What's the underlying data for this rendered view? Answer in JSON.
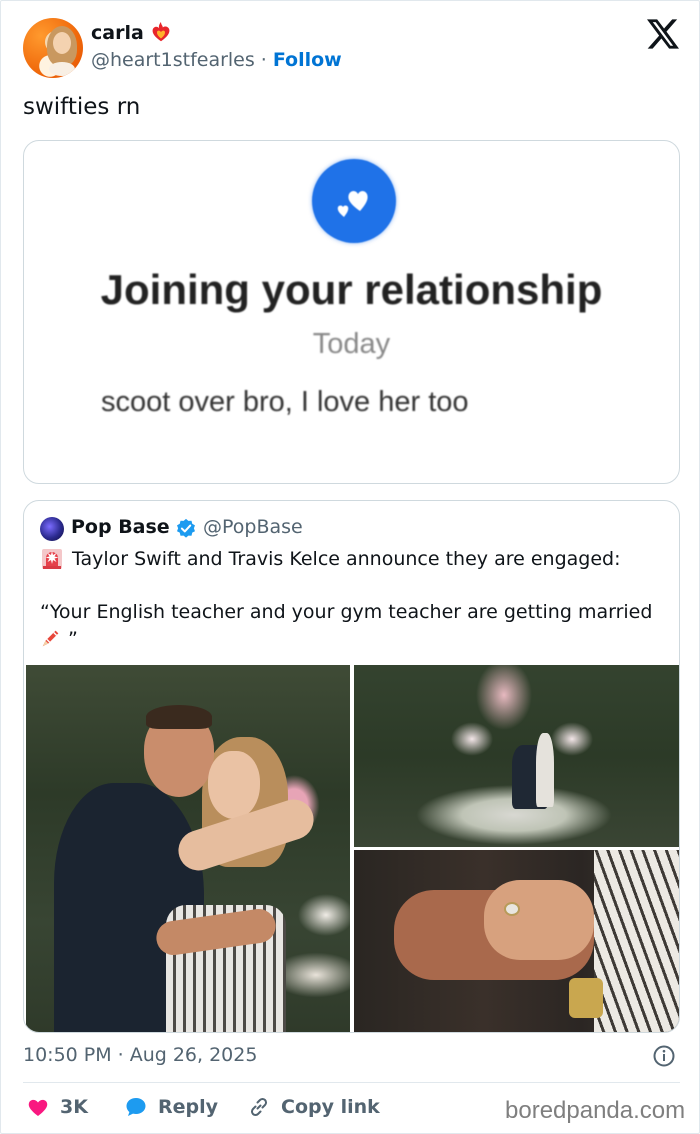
{
  "author": {
    "display_name": "carla",
    "handle": "@heart1stfearles",
    "separator": "·",
    "follow_label": "Follow",
    "badge_icon": "flaming-heart-icon"
  },
  "platform_logo": "x-logo-icon",
  "tweet": {
    "text": "swifties rn"
  },
  "screenshot_card": {
    "icon": "hearts-icon",
    "title": "Joining your relationship",
    "date": "Today",
    "message": "scoot over bro, I love her too",
    "accent": "#1f72e8"
  },
  "quoted_tweet": {
    "display_name": "Pop Base",
    "handle": "@PopBase",
    "verified": true,
    "line1_emoji": "siren-icon",
    "line1": "Taylor Swift and Travis Kelce announce they are engaged:",
    "line2": "“Your English teacher and your gym teacher are getting married",
    "line2_emoji": "crayon-icon",
    "line2_close": "”",
    "photos": [
      "couple-embrace-photo",
      "garden-proposal-photo",
      "hands-ring-photo"
    ]
  },
  "meta": {
    "time": "10:50 PM",
    "separator": "·",
    "date": "Aug 26, 2025"
  },
  "actions": {
    "like_count": "3K",
    "reply_label": "Reply",
    "copy_label": "Copy link"
  },
  "colors": {
    "like": "#f91880",
    "reply": "#1d9bf0",
    "follow": "#0074d4",
    "verified": "#1d9bf0"
  },
  "watermark": "boredpanda.com"
}
